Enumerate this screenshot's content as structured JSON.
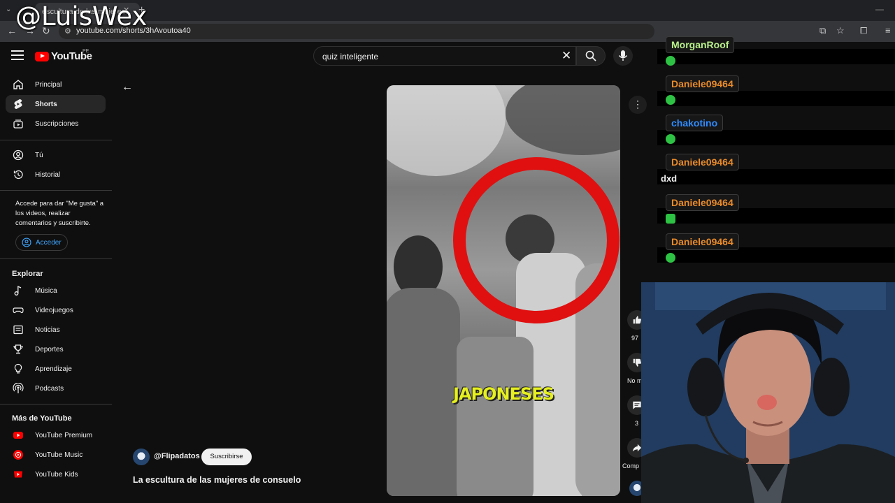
{
  "browser": {
    "tab_title": "escultura de las mujeres...",
    "url": "youtube.com/shorts/3hAvoutoa40"
  },
  "watermark": "@LuisWex",
  "header": {
    "logo_text": "YouTube",
    "region": "PE",
    "search_value": "quiz inteligente"
  },
  "sidebar": {
    "items": [
      {
        "label": "Principal",
        "icon": "home-icon"
      },
      {
        "label": "Shorts",
        "icon": "shorts-icon",
        "active": true
      },
      {
        "label": "Suscripciones",
        "icon": "subscriptions-icon"
      }
    ],
    "you_items": [
      {
        "label": "Tú",
        "icon": "user-icon"
      },
      {
        "label": "Historial",
        "icon": "history-icon"
      }
    ],
    "signin_prompt": "Accede para dar \"Me gusta\" a los videos, realizar comentarios y suscribirte.",
    "signin_label": "Acceder",
    "explore_heading": "Explorar",
    "explore_items": [
      {
        "label": "Música",
        "icon": "music-icon"
      },
      {
        "label": "Videojuegos",
        "icon": "gaming-icon"
      },
      {
        "label": "Noticias",
        "icon": "news-icon"
      },
      {
        "label": "Deportes",
        "icon": "trophy-icon"
      },
      {
        "label": "Aprendizaje",
        "icon": "lightbulb-icon"
      },
      {
        "label": "Podcasts",
        "icon": "podcast-icon"
      }
    ],
    "more_heading": "Más de YouTube",
    "more_items": [
      {
        "label": "YouTube Premium",
        "icon": "youtube-premium-icon"
      },
      {
        "label": "YouTube Music",
        "icon": "youtube-music-icon"
      },
      {
        "label": "YouTube Kids",
        "icon": "youtube-kids-icon"
      }
    ]
  },
  "short": {
    "channel": "@Flipadatos",
    "subscribe_label": "Suscribirse",
    "title": "La escultura de las mujeres de consuelo",
    "subtitle": "JAPONESES",
    "like_count": "97",
    "dislike_label": "No m",
    "comment_count": "3",
    "share_label": "Comp"
  },
  "chat": {
    "messages": [
      {
        "user": "MorganRoof",
        "color": "#b8f08a",
        "emote": true,
        "text": ""
      },
      {
        "user": "Daniele09464",
        "color": "#e88a2a",
        "emote": true,
        "text": ""
      },
      {
        "user": "chakotino",
        "color": "#2e8cff",
        "emote": true,
        "text": ""
      },
      {
        "user": "Daniele09464",
        "color": "#e88a2a",
        "emote": false,
        "text": "dxd"
      },
      {
        "user": "Daniele09464",
        "color": "#e88a2a",
        "emote": true,
        "text": ""
      },
      {
        "user": "Daniele09464",
        "color": "#e88a2a",
        "emote": true,
        "text": ""
      }
    ]
  },
  "colors": {
    "accent_red": "#ff0000",
    "link_blue": "#3ea6ff",
    "subtitle_yellow": "#e6f020"
  }
}
